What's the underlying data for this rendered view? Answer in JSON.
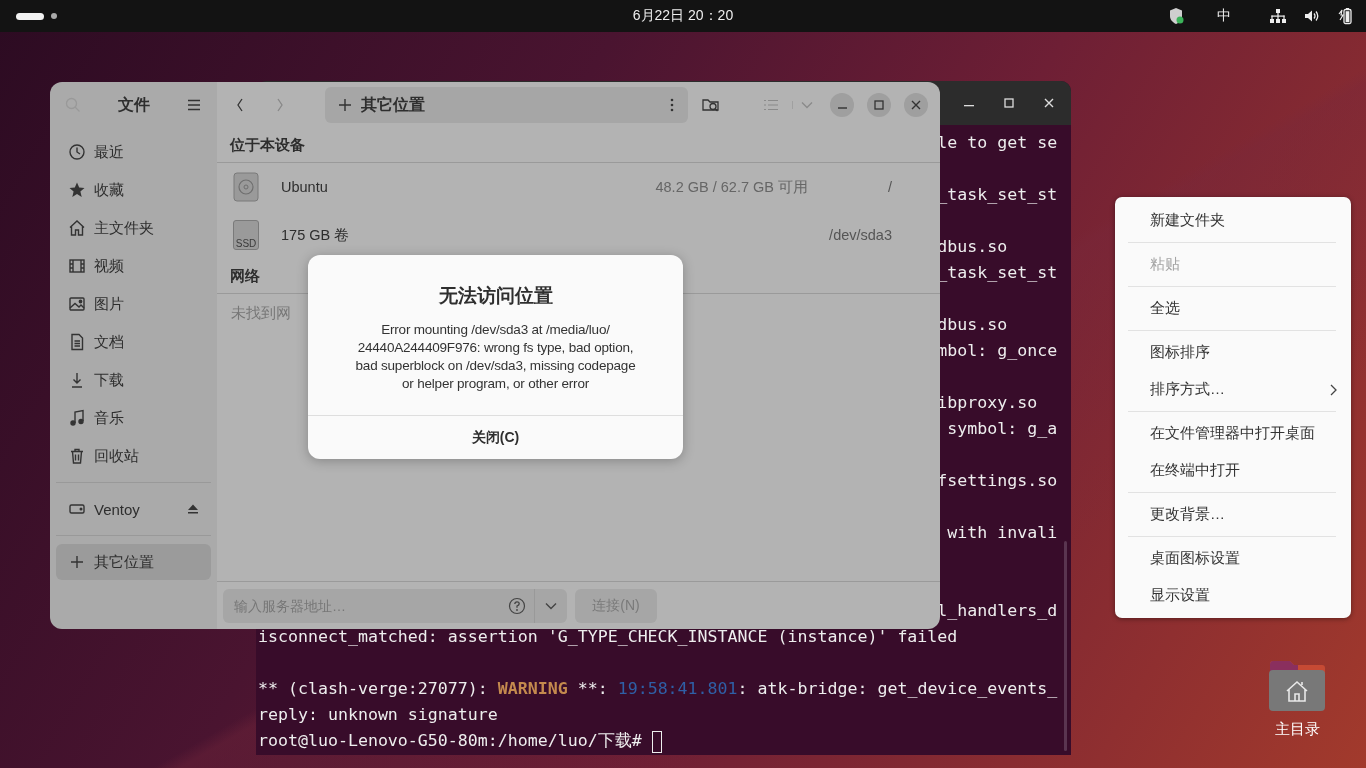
{
  "top_bar": {
    "clock": "6月22日 20：20",
    "input_method": "中"
  },
  "terminal": {
    "lines": [
      {
        "kind": "cut",
        "text": "le to get se"
      },
      {
        "kind": "blank"
      },
      {
        "kind": "cut",
        "text": "_task_set_st"
      },
      {
        "kind": "blank"
      },
      {
        "kind": "cut",
        "text": "dbus.so"
      },
      {
        "kind": "cut",
        "text": "_task_set_st"
      },
      {
        "kind": "blank"
      },
      {
        "kind": "cut",
        "text": "dbus.so"
      },
      {
        "kind": "cut",
        "text": "mbol: g_once"
      },
      {
        "kind": "blank"
      },
      {
        "kind": "cut",
        "text": "ibproxy.so"
      },
      {
        "kind": "cut",
        "text": " symbol: g_a"
      },
      {
        "kind": "blank"
      },
      {
        "kind": "cut",
        "text": "fsettings.so"
      },
      {
        "kind": "blank"
      },
      {
        "kind": "cut",
        "text": " with invali"
      },
      {
        "kind": "blank"
      },
      {
        "kind": "blank"
      },
      {
        "kind": "cut",
        "text": "l_handlers_d"
      },
      {
        "kind": "full",
        "text": "isconnect_matched: assertion 'G_TYPE_CHECK_INSTANCE (instance)' failed"
      },
      {
        "kind": "blank"
      },
      {
        "kind": "segments",
        "segments": [
          {
            "text": "** (clash-verge:27077): "
          },
          {
            "text": "WARNING",
            "color": "#c48a4e",
            "bold": true
          },
          {
            "text": " **: "
          },
          {
            "text": "19:58:41.801",
            "color": "#2f5fa6",
            "bold": false
          },
          {
            "text": ": atk-bridge: get_device_events_"
          }
        ]
      },
      {
        "kind": "full",
        "text": "reply: unknown signature"
      },
      {
        "kind": "prompt",
        "text": "root@luo-Lenovo-G50-80m:/home/luo/下载# "
      }
    ]
  },
  "files": {
    "sidebar": {
      "title": "文件",
      "groups": [
        [
          {
            "label": "最近",
            "selected": false,
            "eject": false
          },
          {
            "label": "收藏",
            "selected": false,
            "eject": false
          },
          {
            "label": "主文件夹",
            "selected": false,
            "eject": false
          },
          {
            "label": "视频",
            "selected": false,
            "eject": false
          },
          {
            "label": "图片",
            "selected": false,
            "eject": false
          },
          {
            "label": "文档",
            "selected": false,
            "eject": false
          },
          {
            "label": "下载",
            "selected": false,
            "eject": false
          },
          {
            "label": "音乐",
            "selected": false,
            "eject": false
          },
          {
            "label": "回收站",
            "selected": false,
            "eject": false
          }
        ],
        [
          {
            "label": "Ventoy",
            "selected": false,
            "eject": true
          }
        ],
        [
          {
            "label": "其它位置",
            "selected": true,
            "eject": false
          }
        ]
      ]
    },
    "path": "其它位置",
    "sections": [
      {
        "title": "位于本设备",
        "rows": [
          {
            "kind": "disk",
            "name": "Ubuntu",
            "usage": "48.2 GB / 62.7 GB 可用",
            "path": "/"
          },
          {
            "kind": "ssd",
            "icon_label": "SSD",
            "name": "175 GB 卷",
            "path": "/dev/sda3"
          }
        ]
      },
      {
        "title": "网络",
        "empty_text": "未找到网"
      }
    ],
    "server_field": {
      "placeholder": "输入服务器地址…"
    },
    "connect_button": {
      "label": "连接(N)",
      "disabled": true
    }
  },
  "dialog": {
    "title": "无法访问位置",
    "message_lines": [
      "Error mounting /dev/sda3 at /media/luo/",
      "24440A244409F976: wrong fs type, bad option,",
      "bad superblock on /dev/sda3, missing codepage",
      "or helper program, or other error"
    ],
    "button": "关闭(C)"
  },
  "menu": {
    "groups": [
      [
        {
          "label": "新建文件夹",
          "disabled": false,
          "submenu": false
        }
      ],
      [
        {
          "label": "粘贴",
          "disabled": true,
          "submenu": false
        }
      ],
      [
        {
          "label": "全选",
          "disabled": false,
          "submenu": false
        }
      ],
      [
        {
          "label": "图标排序",
          "disabled": false,
          "submenu": false
        },
        {
          "label": "排序方式…",
          "disabled": false,
          "submenu": true
        }
      ],
      [
        {
          "label": "在文件管理器中打开桌面",
          "disabled": false,
          "submenu": false
        },
        {
          "label": "在终端中打开",
          "disabled": false,
          "submenu": false
        }
      ],
      [
        {
          "label": "更改背景…",
          "disabled": false,
          "submenu": false
        }
      ],
      [
        {
          "label": "桌面图标设置",
          "disabled": false,
          "submenu": false
        },
        {
          "label": "显示设置",
          "disabled": false,
          "submenu": false
        }
      ]
    ]
  },
  "desktop_icon": {
    "label": "主目录"
  }
}
